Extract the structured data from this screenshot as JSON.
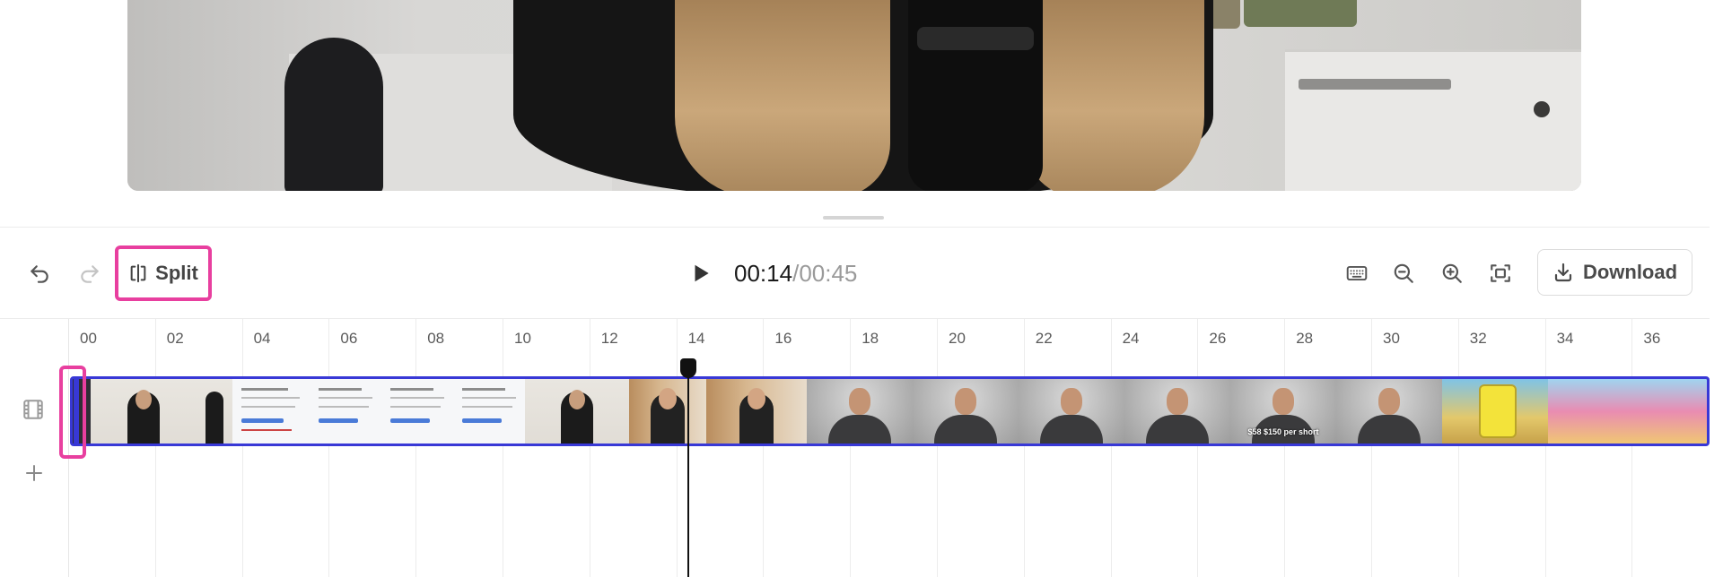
{
  "toolbar": {
    "split_label": "Split",
    "time_current": "00:14",
    "time_separator": "/",
    "time_total": "00:45",
    "download_label": "Download"
  },
  "timeline": {
    "ruler_labels": [
      "00",
      "02",
      "04",
      "06",
      "08",
      "10",
      "12",
      "14",
      "16",
      "18",
      "20",
      "22",
      "24",
      "26",
      "28",
      "30",
      "32",
      "34",
      "36"
    ],
    "caption_text": "$58 $150 per short"
  },
  "icons": {
    "undo": "undo-icon",
    "redo": "redo-icon",
    "split": "split-icon",
    "play": "play-icon",
    "keyboard": "keyboard-icon",
    "zoom_out": "zoom-out-icon",
    "zoom_in": "zoom-in-icon",
    "fit": "fit-to-screen-icon",
    "download": "download-icon",
    "film": "film-icon",
    "add": "plus-icon"
  },
  "colors": {
    "highlight": "#e83f9f",
    "track_border": "#3838d6",
    "playhead": "#111111"
  }
}
